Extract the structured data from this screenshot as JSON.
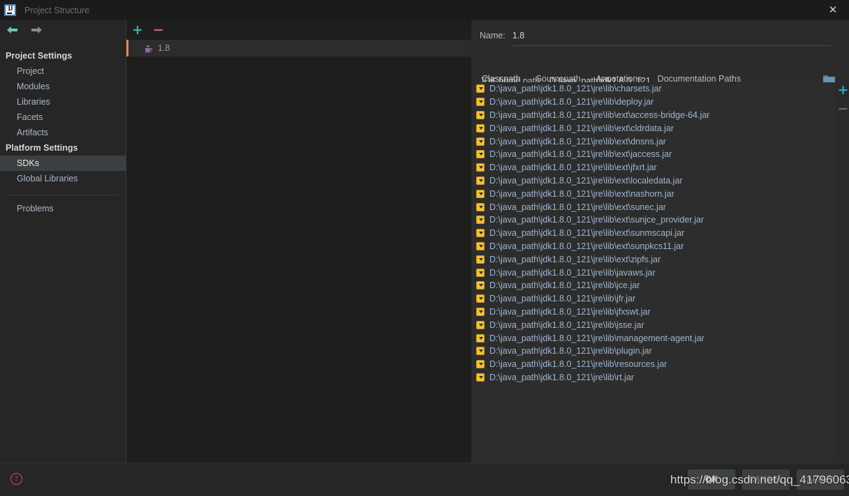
{
  "window": {
    "title": "Project Structure",
    "logo_text": "IJ",
    "close_label": "✕"
  },
  "nav": {
    "back_label": "back-arrow",
    "forward_label": "forward-arrow"
  },
  "sidebar": {
    "groups": [
      {
        "label": "Project Settings",
        "items": [
          {
            "label": "Project",
            "selected": false
          },
          {
            "label": "Modules",
            "selected": false
          },
          {
            "label": "Libraries",
            "selected": false
          },
          {
            "label": "Facets",
            "selected": false
          },
          {
            "label": "Artifacts",
            "selected": false
          }
        ]
      },
      {
        "label": "Platform Settings",
        "items": [
          {
            "label": "SDKs",
            "selected": true
          },
          {
            "label": "Global Libraries",
            "selected": false
          }
        ]
      }
    ],
    "extra_items": [
      {
        "label": "Problems",
        "selected": false
      }
    ]
  },
  "sdk_panel": {
    "add_label": "+",
    "remove_label": "−",
    "items": [
      {
        "label": "1.8",
        "icon": "java-coffee-icon",
        "selected": true
      }
    ]
  },
  "detail": {
    "name_label": "Name:",
    "name_value": "1.8",
    "jdk_home_label": "JDK home path:",
    "jdk_home_value": "D:\\java_path\\jdk1.8.0_121",
    "browse_icon": "folder-icon",
    "tabs": [
      {
        "label": "Classpath",
        "active": true
      },
      {
        "label": "Sourcepath",
        "active": false
      },
      {
        "label": "Annotations",
        "active": false
      },
      {
        "label": "Documentation Paths",
        "active": false
      }
    ],
    "list_add_label": "+",
    "list_remove_label": "−",
    "classpath_entries": [
      "D:\\java_path\\jdk1.8.0_121\\jre\\lib\\charsets.jar",
      "D:\\java_path\\jdk1.8.0_121\\jre\\lib\\deploy.jar",
      "D:\\java_path\\jdk1.8.0_121\\jre\\lib\\ext\\access-bridge-64.jar",
      "D:\\java_path\\jdk1.8.0_121\\jre\\lib\\ext\\cldrdata.jar",
      "D:\\java_path\\jdk1.8.0_121\\jre\\lib\\ext\\dnsns.jar",
      "D:\\java_path\\jdk1.8.0_121\\jre\\lib\\ext\\jaccess.jar",
      "D:\\java_path\\jdk1.8.0_121\\jre\\lib\\ext\\jfxrt.jar",
      "D:\\java_path\\jdk1.8.0_121\\jre\\lib\\ext\\localedata.jar",
      "D:\\java_path\\jdk1.8.0_121\\jre\\lib\\ext\\nashorn.jar",
      "D:\\java_path\\jdk1.8.0_121\\jre\\lib\\ext\\sunec.jar",
      "D:\\java_path\\jdk1.8.0_121\\jre\\lib\\ext\\sunjce_provider.jar",
      "D:\\java_path\\jdk1.8.0_121\\jre\\lib\\ext\\sunmscapi.jar",
      "D:\\java_path\\jdk1.8.0_121\\jre\\lib\\ext\\sunpkcs11.jar",
      "D:\\java_path\\jdk1.8.0_121\\jre\\lib\\ext\\zipfs.jar",
      "D:\\java_path\\jdk1.8.0_121\\jre\\lib\\javaws.jar",
      "D:\\java_path\\jdk1.8.0_121\\jre\\lib\\jce.jar",
      "D:\\java_path\\jdk1.8.0_121\\jre\\lib\\jfr.jar",
      "D:\\java_path\\jdk1.8.0_121\\jre\\lib\\jfxswt.jar",
      "D:\\java_path\\jdk1.8.0_121\\jre\\lib\\jsse.jar",
      "D:\\java_path\\jdk1.8.0_121\\jre\\lib\\management-agent.jar",
      "D:\\java_path\\jdk1.8.0_121\\jre\\lib\\plugin.jar",
      "D:\\java_path\\jdk1.8.0_121\\jre\\lib\\resources.jar",
      "D:\\java_path\\jdk1.8.0_121\\jre\\lib\\rt.jar"
    ]
  },
  "footer": {
    "help_label": "?",
    "buttons": [
      {
        "label": "OK",
        "primary": true
      },
      {
        "label": "CANCEL",
        "primary": false
      },
      {
        "label": "APPLY",
        "primary": false
      }
    ]
  },
  "watermark": {
    "text": "https://blog.csdn.net/qq_41796063"
  },
  "colors": {
    "accent_tab": "#e4755f",
    "add_green": "#2eb8a6",
    "remove_red": "#cf6b63",
    "jar_icon": "#f0c040",
    "link_text": "#9fb6cf",
    "help_pink": "#e2436a"
  }
}
